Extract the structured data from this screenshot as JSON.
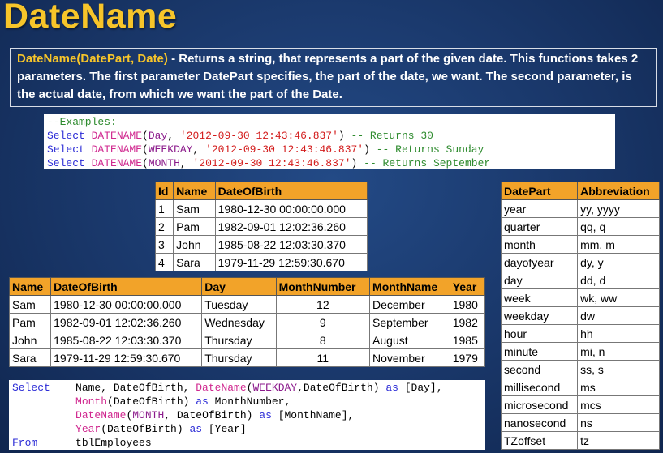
{
  "slide": {
    "title": "DateName",
    "desc_fn": "DateName(DatePart, Date)",
    "desc_rest": " - Returns a string, that represents a part of the given date. This functions takes 2 parameters. The first parameter DatePart specifies, the part of the date, we want. The second parameter, is the actual date, from which we want the part of the Date."
  },
  "examples": {
    "comment": "--Examples:",
    "lines": [
      {
        "kw": "Select",
        "fn": "DATENAME",
        "dp": "Day",
        "str": "'2012-09-30 12:43:46.837'",
        "cmt": "-- Returns 30"
      },
      {
        "kw": "Select",
        "fn": "DATENAME",
        "dp": "WEEKDAY",
        "str": "'2012-09-30 12:43:46.837'",
        "cmt": "-- Returns Sunday"
      },
      {
        "kw": "Select",
        "fn": "DATENAME",
        "dp": "MONTH",
        "str": "'2012-09-30 12:43:46.837'",
        "cmt": "-- Returns September"
      }
    ]
  },
  "emp_table": {
    "headers": [
      "Id",
      "Name",
      "DateOfBirth"
    ],
    "rows": [
      [
        "1",
        "Sam",
        "1980-12-30 00:00:00.000"
      ],
      [
        "2",
        "Pam",
        "1982-09-01 12:02:36.260"
      ],
      [
        "3",
        "John",
        "1985-08-22 12:03:30.370"
      ],
      [
        "4",
        "Sara",
        "1979-11-29 12:59:30.670"
      ]
    ]
  },
  "result_table": {
    "headers": [
      "Name",
      "DateOfBirth",
      "Day",
      "MonthNumber",
      "MonthName",
      "Year"
    ],
    "rows": [
      [
        "Sam",
        "1980-12-30 00:00:00.000",
        "Tuesday",
        "12",
        "December",
        "1980"
      ],
      [
        "Pam",
        "1982-09-01 12:02:36.260",
        "Wednesday",
        "9",
        "September",
        "1982"
      ],
      [
        "John",
        "1985-08-22 12:03:30.370",
        "Thursday",
        "8",
        "August",
        "1985"
      ],
      [
        "Sara",
        "1979-11-29 12:59:30.670",
        "Thursday",
        "11",
        "November",
        "1979"
      ]
    ]
  },
  "datepart_table": {
    "headers": [
      "DatePart",
      "Abbreviation"
    ],
    "rows": [
      [
        "year",
        "yy, yyyy"
      ],
      [
        "quarter",
        "qq, q"
      ],
      [
        "month",
        "mm, m"
      ],
      [
        "dayofyear",
        "dy, y"
      ],
      [
        "day",
        "dd, d"
      ],
      [
        "week",
        "wk, ww"
      ],
      [
        "weekday",
        "dw"
      ],
      [
        "hour",
        "hh"
      ],
      [
        "minute",
        "mi, n"
      ],
      [
        "second",
        "ss, s"
      ],
      [
        "millisecond",
        "ms"
      ],
      [
        "microsecond",
        "mcs"
      ],
      [
        "nanosecond",
        "ns"
      ],
      [
        "TZoffset",
        "tz"
      ]
    ]
  },
  "select_code": {
    "l1_kw": "Select",
    "l1_a": "    Name, DateOfBirth, ",
    "l1_fn": "DateName",
    "l1_dp": "WEEKDAY",
    "l1_b": ",DateOfBirth) ",
    "l1_as": "as",
    "l1_c": " [Day],",
    "l2_fn": "Month",
    "l2_a": "(DateOfBirth) ",
    "l2_as": "as",
    "l2_b": " MonthNumber,",
    "l3_fn": "DateName",
    "l3_dp": "MONTH",
    "l3_a": ", DateOfBirth) ",
    "l3_as": "as",
    "l3_b": " [MonthName],",
    "l4_fn": "Year",
    "l4_a": "(DateOfBirth) ",
    "l4_as": "as",
    "l4_b": " [Year]",
    "l5_kw": "From",
    "l5_a": "      tblEmployees"
  }
}
